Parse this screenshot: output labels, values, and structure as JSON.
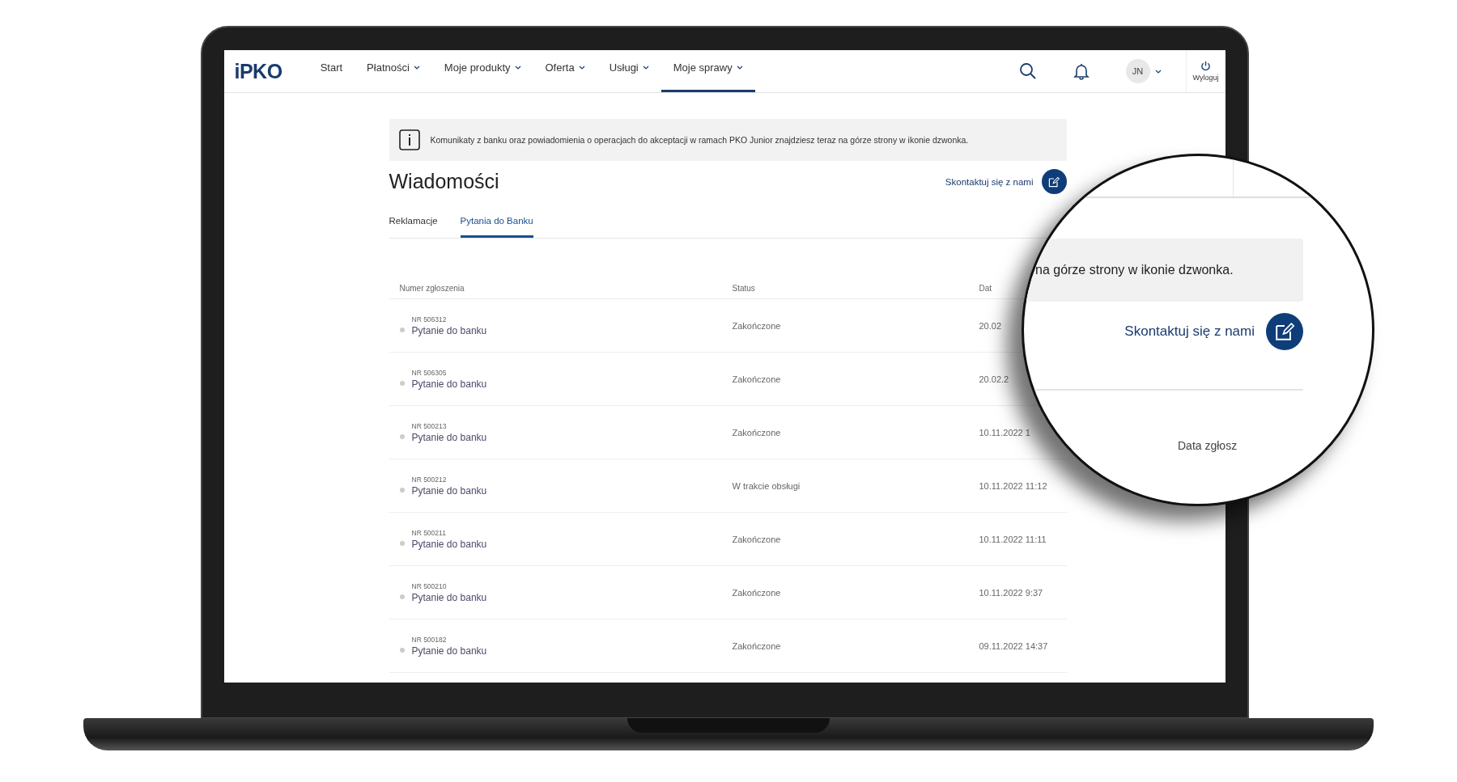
{
  "nav": {
    "logo": "iPKO",
    "items": [
      {
        "label": "Start",
        "dropdown": false,
        "selected": false
      },
      {
        "label": "Płatności",
        "dropdown": true,
        "selected": false
      },
      {
        "label": "Moje produkty",
        "dropdown": true,
        "selected": false
      },
      {
        "label": "Oferta",
        "dropdown": true,
        "selected": false
      },
      {
        "label": "Usługi",
        "dropdown": true,
        "selected": false
      },
      {
        "label": "Moje sprawy",
        "dropdown": true,
        "selected": true
      }
    ],
    "user_initials": "JN",
    "logout": "Wyloguj"
  },
  "info_banner": "Komunikaty z banku oraz powiadomienia o operacjach do akceptacji w ramach PKO Junior znajdziesz teraz na górze strony w ikonie dzwonka.",
  "page_title": "Wiadomości",
  "contact_link": "Skontaktuj się z nami",
  "tabs": [
    {
      "label": "Reklamacje",
      "selected": false
    },
    {
      "label": "Pytania do Banku",
      "selected": true
    }
  ],
  "table": {
    "columns": [
      "Numer zgłoszenia",
      "Status",
      "Dat"
    ],
    "rows": [
      {
        "number": "NR 506312",
        "subject": "Pytanie do banku",
        "status": "Zakończone",
        "date": "20.02"
      },
      {
        "number": "NR 506305",
        "subject": "Pytanie do banku",
        "status": "Zakończone",
        "date": "20.02.2"
      },
      {
        "number": "NR 500213",
        "subject": "Pytanie do banku",
        "status": "Zakończone",
        "date": "10.11.2022 1"
      },
      {
        "number": "NR 500212",
        "subject": "Pytanie do banku",
        "status": "W trakcie obsługi",
        "date": "10.11.2022 11:12"
      },
      {
        "number": "NR 500211",
        "subject": "Pytanie do banku",
        "status": "Zakończone",
        "date": "10.11.2022 11:11"
      },
      {
        "number": "NR 500210",
        "subject": "Pytanie do banku",
        "status": "Zakończone",
        "date": "10.11.2022 9:37"
      },
      {
        "number": "NR 500182",
        "subject": "Pytanie do banku",
        "status": "Zakończone",
        "date": "09.11.2022 14:37"
      }
    ]
  },
  "magnifier": {
    "banner_fragment": "na górze strony w ikonie dzwonka.",
    "contact_link": "Skontaktuj się z nami",
    "column_fragment": "Data zgłosz"
  }
}
